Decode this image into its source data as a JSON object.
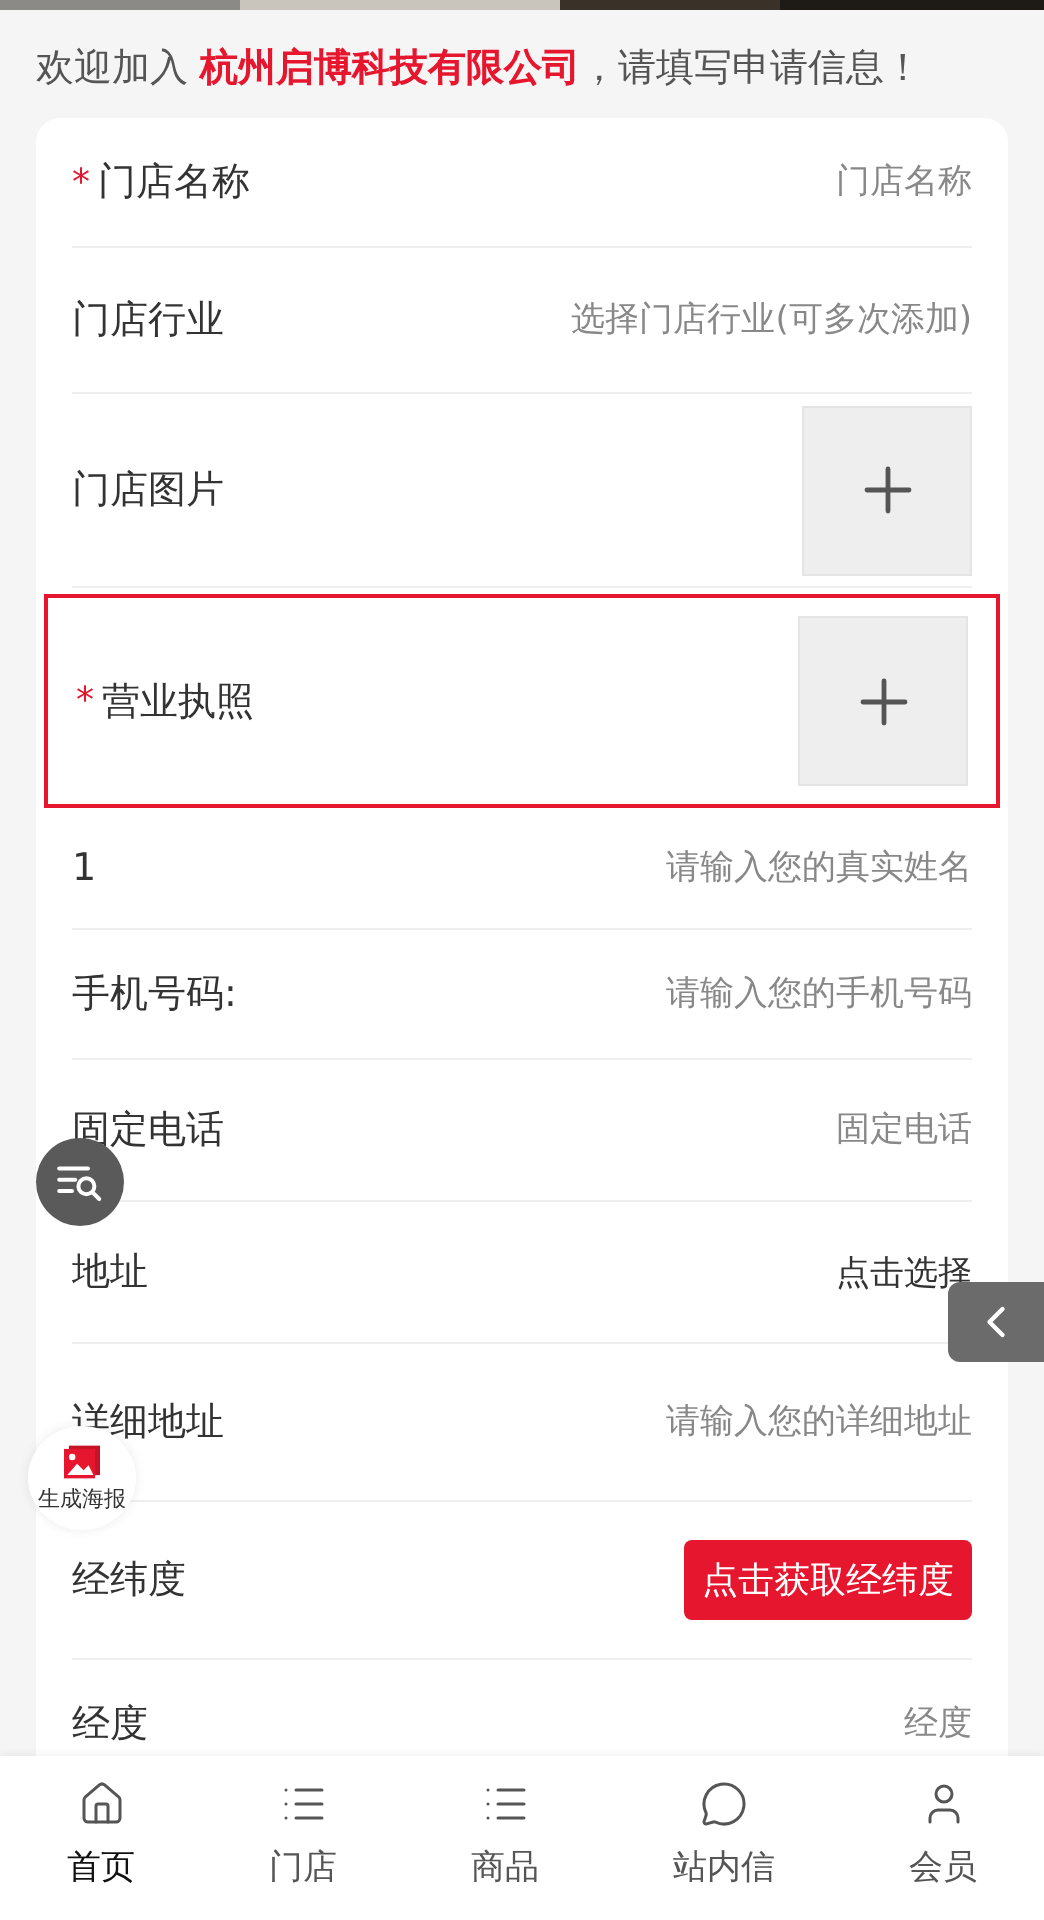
{
  "intro": "欢迎加入 **杭州启博科技有限公司**，请填写申请信息！",
  "form_rows": [
    {
      "kind": "text",
      "label": "门店名称",
      "required_mark": "*",
      "placeholder": "门店名称"
    },
    {
      "kind": "text",
      "label": "门店行业",
      "placeholder": "选择门店行业(可多次添加)"
    },
    {
      "kind": "upload",
      "label": "门店图片",
      "highlighted": false
    },
    {
      "kind": "upload",
      "label": "营业执照",
      "required_mark": "*",
      "highlighted": true
    },
    {
      "kind": "text",
      "label": "1",
      "placeholder": "请输入您的真实姓名"
    },
    {
      "kind": "text",
      "label": "手机号码:",
      "placeholder": "请输入您的手机号码"
    },
    {
      "kind": "text",
      "label": "固定电话",
      "placeholder": "固定电话"
    },
    {
      "kind": "select",
      "label": "地址",
      "value": "点击选择"
    },
    {
      "kind": "text",
      "label": "详细地址",
      "placeholder": "请输入您的详细地址"
    },
    {
      "kind": "button",
      "label": "经纬度",
      "button": "点击获取经纬度"
    },
    {
      "kind": "text",
      "label": "经度",
      "placeholder": "经度"
    }
  ],
  "floating": {
    "poster_button": "生成海报"
  },
  "bottom_nav": [
    {
      "label": "首页",
      "selected": true
    },
    {
      "label": "门店",
      "selected": false
    },
    {
      "label": "商品",
      "selected": false
    },
    {
      "label": "站内信",
      "selected": false
    },
    {
      "label": "会员",
      "selected": false
    }
  ]
}
